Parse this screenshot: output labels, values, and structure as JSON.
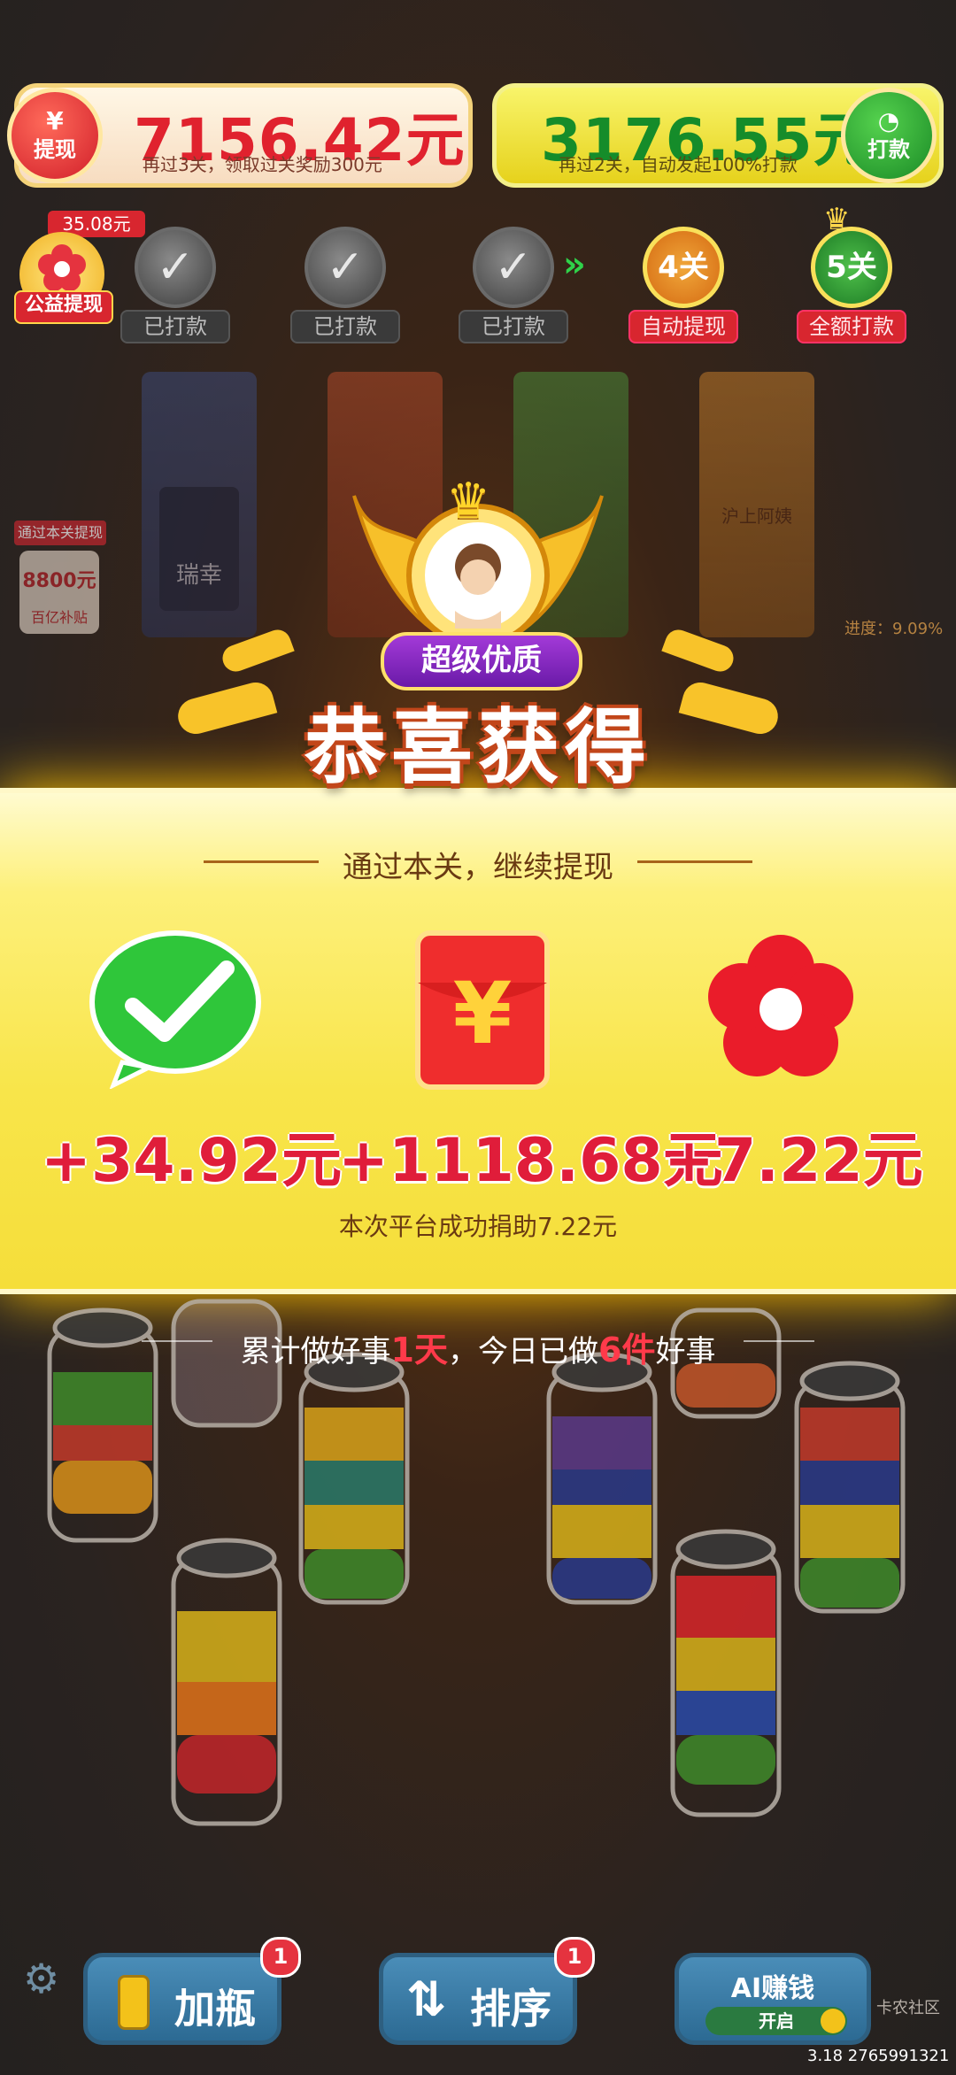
{
  "top_bar": {
    "withdraw": {
      "icon": "yen-icon",
      "label": "提现",
      "amount": "7156.42元",
      "subtitle": "再过3关，领取过关奖励300元"
    },
    "payout": {
      "icon": "clock-icon",
      "label": "打款",
      "amount": "3176.55元",
      "subtitle": "再过2关，自动发起100%打款"
    }
  },
  "charity": {
    "badge": "35.08元",
    "label": "公益提现"
  },
  "progress": {
    "steps": [
      {
        "state": "done",
        "label": "已打款"
      },
      {
        "state": "done",
        "label": "已打款"
      },
      {
        "state": "done",
        "label": "已打款"
      },
      {
        "state": "level",
        "level": "4关",
        "label": "自动提现"
      },
      {
        "state": "level",
        "level": "5关",
        "label": "全额打款"
      }
    ]
  },
  "bags": [
    "瑞幸",
    "",
    "",
    "沪上阿姨"
  ],
  "side_offer": {
    "title": "通过本关提现",
    "amount": "8800元",
    "caption": "百亿补贴"
  },
  "side_progress": "进度：9.09%",
  "popup": {
    "badge": "超级优质",
    "title": "恭喜获得",
    "subtitle": "通过本关，继续提现",
    "rewards": [
      {
        "icon": "wechat-icon",
        "value": "+34.92元"
      },
      {
        "icon": "red-envelope-icon",
        "value": "+1118.68元"
      },
      {
        "icon": "red-flower-icon",
        "value": "+7.22元"
      }
    ],
    "donation": "本次平台成功捐助7.22元",
    "good_deeds": {
      "prefix": "累计做好事",
      "days": "1天",
      "middle": "，今日已做",
      "count": "6件",
      "suffix": "好事"
    }
  },
  "bottom": {
    "add_bottle": {
      "label": "加瓶",
      "badge": "1"
    },
    "sort": {
      "label": "排序",
      "badge": "1"
    },
    "ai": {
      "label": "AI赚钱",
      "toggle": "开启"
    }
  },
  "watermark": "卡农社区",
  "version": "3.18 2765991321",
  "colors": {
    "accent_red": "#e01d3a",
    "accent_green": "#158c2a",
    "banner_yellow": "#f8e54a"
  }
}
